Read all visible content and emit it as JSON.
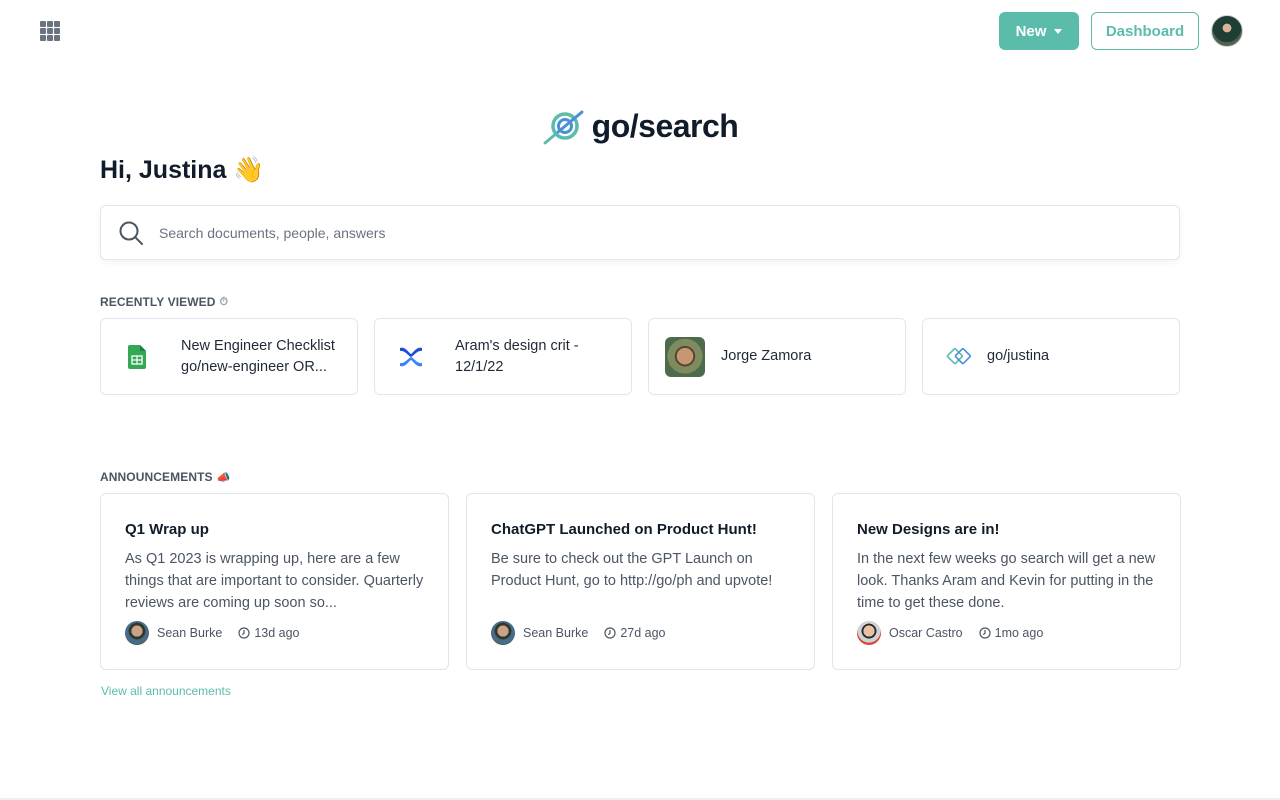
{
  "header": {
    "apps_icon": "grid-icon",
    "new_label": "New",
    "dashboard_label": "Dashboard",
    "avatar_alt": "Justina"
  },
  "logo": {
    "text": "go/search",
    "icon": "target-search-icon"
  },
  "greeting": {
    "text": "Hi, Justina 👋"
  },
  "search": {
    "placeholder": "Search documents, people, answers",
    "value": ""
  },
  "recently_viewed": {
    "title": "RECENTLY VIEWED",
    "title_icon": "⏱",
    "items": [
      {
        "icon": "google-sheets-icon",
        "line1": "New Engineer Checklist",
        "line2": "go/new-engineer OR..."
      },
      {
        "icon": "confluence-icon",
        "line1": "Aram's design crit -",
        "line2": "12/1/22"
      },
      {
        "icon": "person-photo",
        "line1": "Jorge Zamora",
        "line2": ""
      },
      {
        "icon": "golink-icon",
        "line1": "go/justina",
        "line2": ""
      }
    ]
  },
  "announcements": {
    "title": "ANNOUNCEMENTS",
    "title_icon": "📣",
    "items": [
      {
        "title": "Q1 Wrap up",
        "body": "As Q1 2023 is wrapping up, here are a few things that are important to consider. Quarterly reviews are coming up soon so...",
        "author": "Sean Burke",
        "time": "13d ago"
      },
      {
        "title": "ChatGPT Launched on Product Hunt!",
        "body": "Be sure to check out the GPT Launch on Product Hunt, go to http://go/ph and upvote!",
        "author": "Sean Burke",
        "time": "27d ago"
      },
      {
        "title": "New Designs are in!",
        "body": "In the next few weeks go search will get a new look. Thanks Aram and Kevin for putting in the time to get these done.",
        "author": "Oscar Castro",
        "time": "1mo ago"
      }
    ],
    "view_all_label": "View all announcements"
  },
  "colors": {
    "accent": "#5bbcab",
    "heading": "#111c2b",
    "body_text": "#4b5563",
    "border": "#e2e5e9"
  }
}
